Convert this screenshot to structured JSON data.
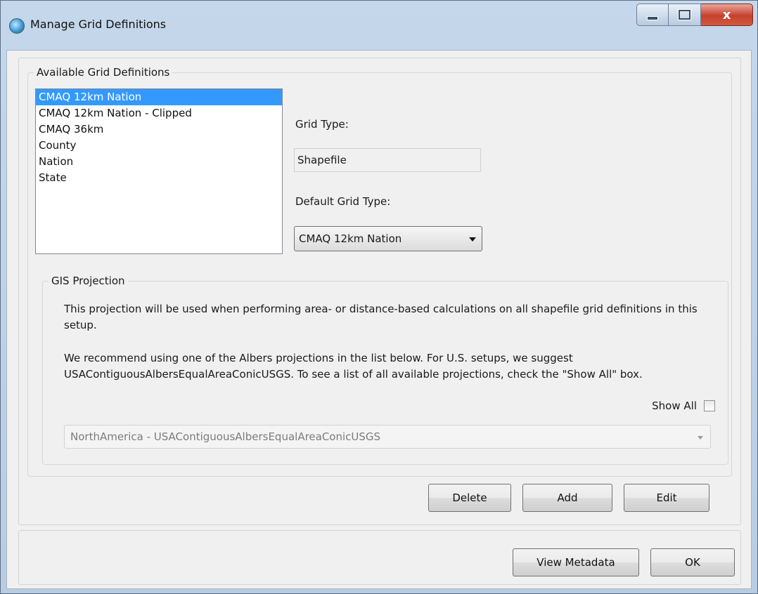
{
  "window": {
    "title": "Manage Grid Definitions",
    "close_glyph": "x"
  },
  "available": {
    "legend": "Available Grid Definitions",
    "items": [
      {
        "label": "CMAQ 12km Nation"
      },
      {
        "label": "CMAQ 12km Nation - Clipped"
      },
      {
        "label": "CMAQ 36km"
      },
      {
        "label": "County"
      },
      {
        "label": "Nation"
      },
      {
        "label": "State"
      }
    ],
    "selected_index": 0,
    "grid_type_label": "Grid Type:",
    "grid_type_value": "Shapefile",
    "default_grid_type_label": "Default Grid Type:",
    "default_grid_type_value": "CMAQ 12km Nation"
  },
  "gis": {
    "legend": "GIS Projection",
    "paragraph1": "This projection will be used when performing area- or distance-based calculations on all shapefile grid definitions in this setup.",
    "paragraph2": "We recommend using one of the Albers projections in the list below. For U.S. setups, we suggest USAContiguousAlbersEqualAreaConicUSGS. To see a list of all available projections, check the \"Show All\" box.",
    "show_all_label": "Show All",
    "projection_value": "NorthAmerica - USAContiguousAlbersEqualAreaConicUSGS"
  },
  "buttons": {
    "delete": "Delete",
    "add": "Add",
    "edit": "Edit",
    "view_metadata": "View Metadata",
    "ok": "OK"
  }
}
